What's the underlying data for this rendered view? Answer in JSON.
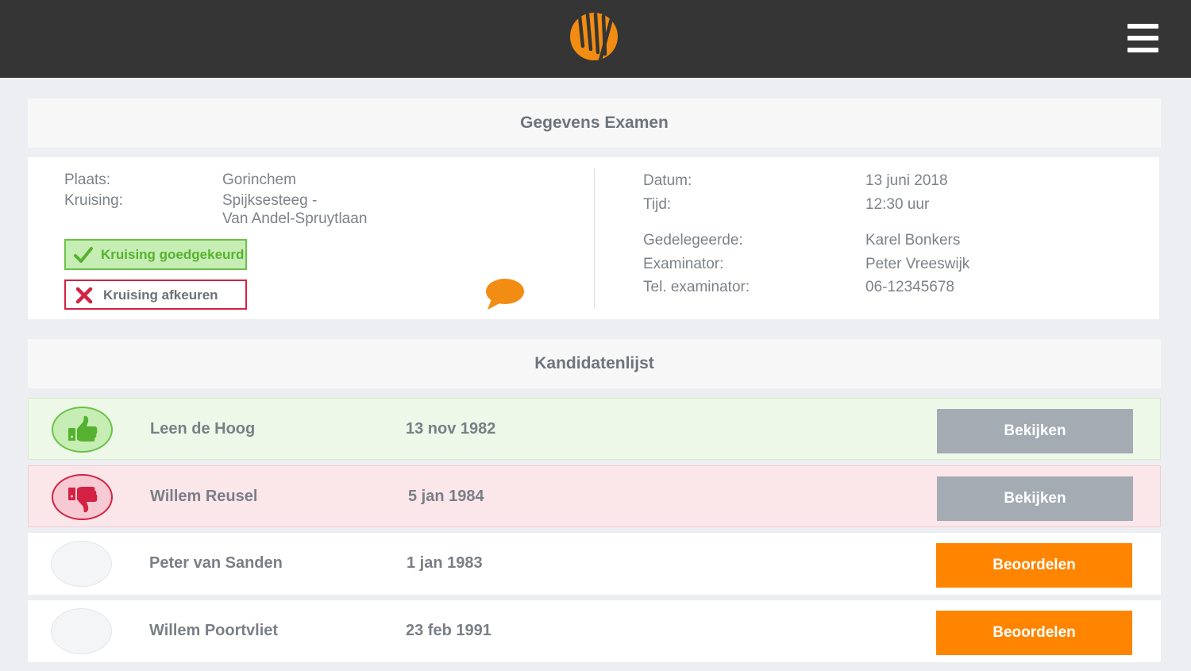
{
  "header": {
    "logo_icon": "stripes-logo-icon",
    "menu_icon": "hamburger-menu-icon"
  },
  "exam": {
    "title": "Gegevens Examen",
    "plaats_label": "Plaats:",
    "plaats_value": "Gorinchem",
    "kruising_label": "Kruising:",
    "kruising_value_line1": "Spijksesteeg -",
    "kruising_value_line2": "Van Andel-Spruytlaan",
    "approve_label": "Kruising goedgekeurd",
    "reject_label": "Kruising afkeuren",
    "datum_label": "Datum:",
    "datum_value": "13 juni 2018",
    "tijd_label": "Tijd:",
    "tijd_value": "12:30 uur",
    "gedelegeerde_label": "Gedelegeerde:",
    "gedelegeerde_value": "Karel Bonkers",
    "examinator_label": "Examinator:",
    "examinator_value": "Peter Vreeswijk",
    "tel_label": "Tel. examinator:",
    "tel_value": "06-12345678"
  },
  "candidates": {
    "title": "Kandidatenlijst",
    "rows": [
      {
        "name": "Leen de Hoog",
        "dob": "13 nov 1982",
        "status": "approved",
        "action": "Bekijken"
      },
      {
        "name": "Willem Reusel",
        "dob": "5 jan 1984",
        "status": "rejected",
        "action": "Bekijken"
      },
      {
        "name": "Peter van Sanden",
        "dob": "1 jan 1983",
        "status": "pending",
        "action": "Beoordelen"
      },
      {
        "name": "Willem Poortvliet",
        "dob": "23 feb 1991",
        "status": "pending",
        "action": "Beoordelen"
      }
    ]
  },
  "colors": {
    "topbar": "#353535",
    "accent_orange": "#ff8500",
    "approve_green": "#6ac14a",
    "reject_red": "#d32243",
    "neutral_button": "#a4abb3"
  }
}
